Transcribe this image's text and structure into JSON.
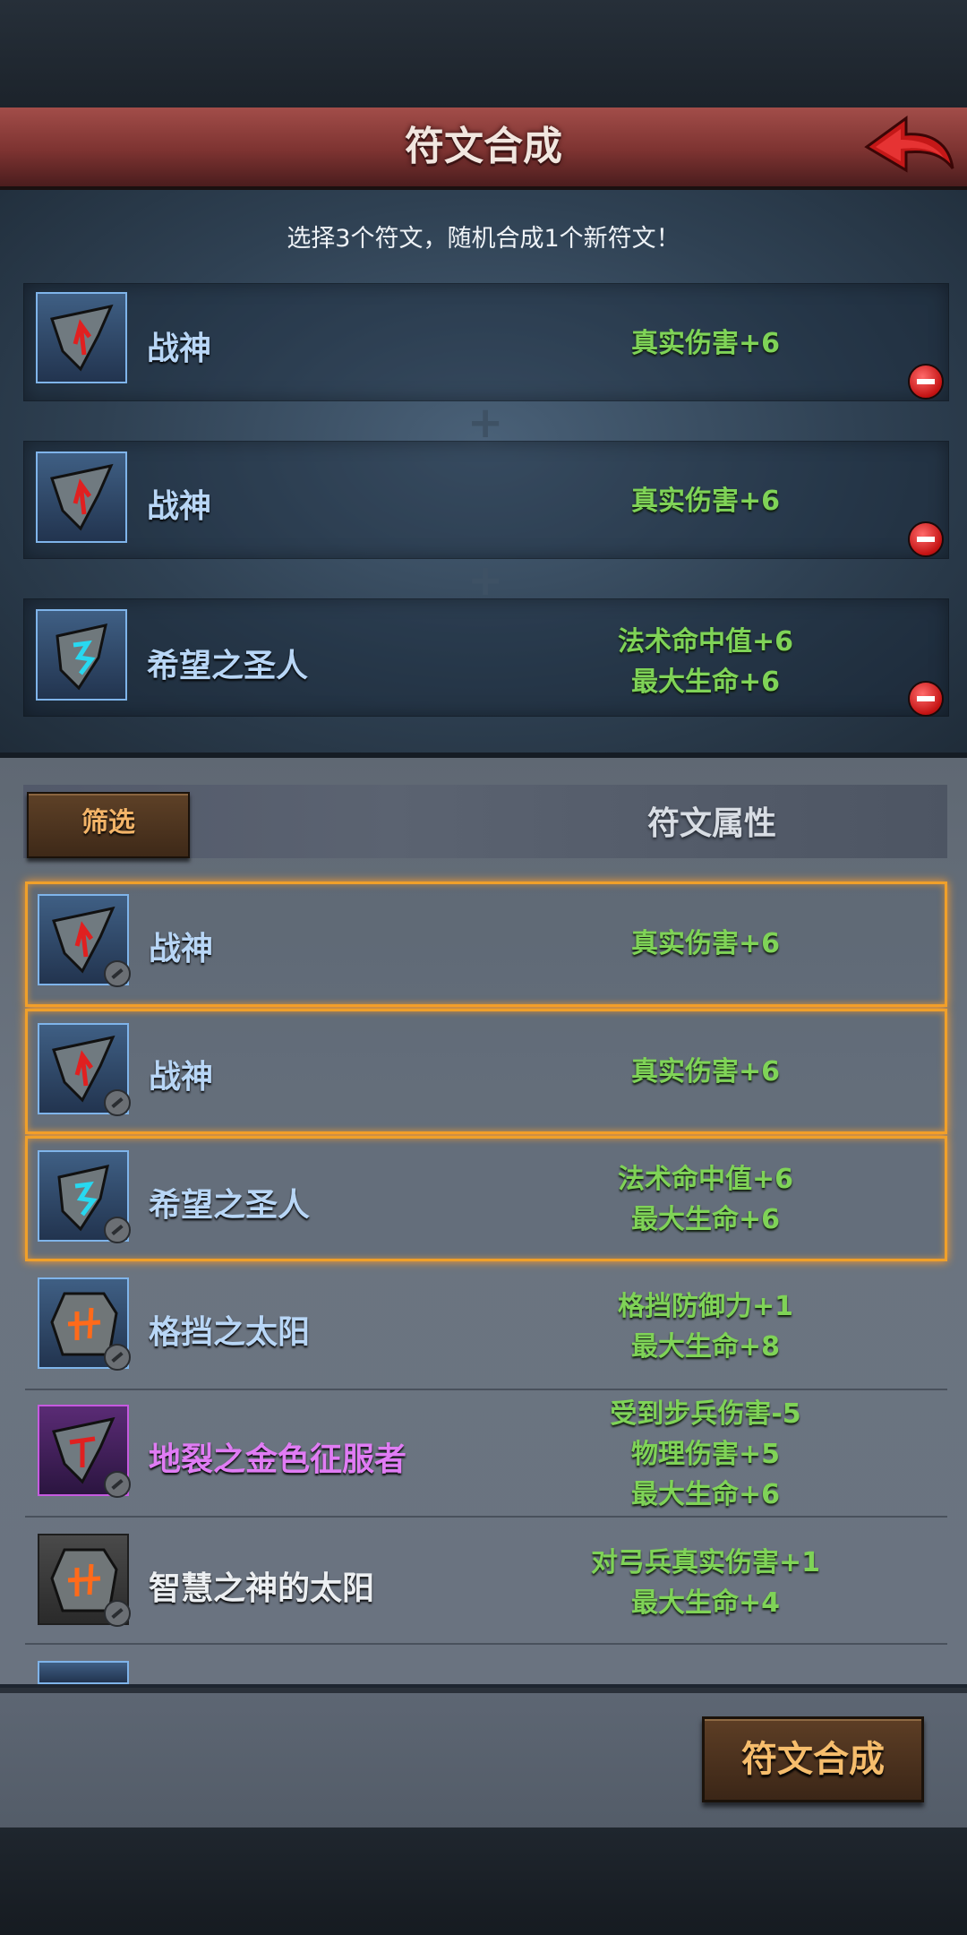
{
  "header": {
    "title": "符文合成",
    "back_icon": "back-arrow-icon"
  },
  "instruction": "选择3个符文，随机合成1个新符文！",
  "selected_slots": [
    {
      "name": "战神",
      "stats": [
        "真实伤害+6"
      ],
      "rune": "red"
    },
    {
      "name": "战神",
      "stats": [
        "真实伤害+6"
      ],
      "rune": "red"
    },
    {
      "name": "希望之圣人",
      "stats": [
        "法术命中值+6",
        "最大生命+6"
      ],
      "rune": "blue"
    }
  ],
  "list": {
    "filter_label": "筛选",
    "attr_label": "符文属性",
    "items": [
      {
        "name": "战神",
        "stats": [
          "真实伤害+6"
        ],
        "selected": true,
        "quality": "blue",
        "rune": "red"
      },
      {
        "name": "战神",
        "stats": [
          "真实伤害+6"
        ],
        "selected": true,
        "quality": "blue",
        "rune": "red"
      },
      {
        "name": "希望之圣人",
        "stats": [
          "法术命中值+6",
          "最大生命+6"
        ],
        "selected": true,
        "quality": "blue",
        "rune": "blue"
      },
      {
        "name": "格挡之太阳",
        "stats": [
          "格挡防御力+1",
          "最大生命+8"
        ],
        "selected": false,
        "quality": "blue",
        "rune": "orange"
      },
      {
        "name": "地裂之金色征服者",
        "stats": [
          "受到步兵伤害-5",
          "物理伤害+5",
          "最大生命+6"
        ],
        "selected": false,
        "quality": "purple",
        "rune": "red"
      },
      {
        "name": "智慧之神的太阳",
        "stats": [
          "对弓兵真实伤害+1",
          "最大生命+4"
        ],
        "selected": false,
        "quality": "gray",
        "rune": "orange"
      }
    ]
  },
  "synthesize_label": "符文合成",
  "colors": {
    "stat_green": "#7fd357",
    "name_blue": "#b8d6f6",
    "name_purple": "#e07cf4",
    "select_glow": "#f0a02a"
  }
}
